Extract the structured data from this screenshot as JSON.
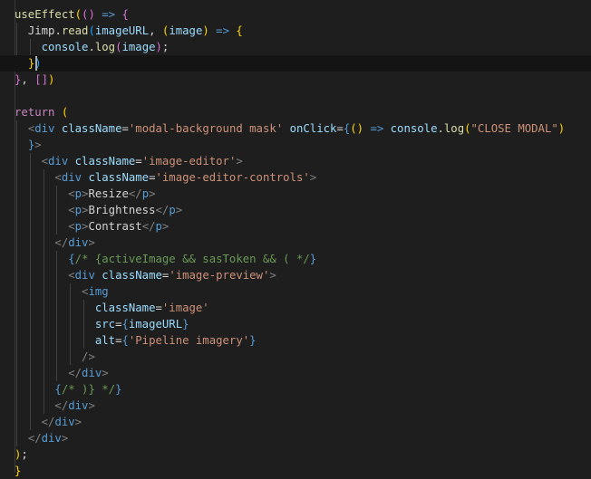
{
  "colors": {
    "background": "#1e1e1e",
    "current_line": "#141414",
    "default": "#d4d4d4",
    "keyword": "#c586c0",
    "storage": "#569cd6",
    "function": "#dcdcaa",
    "variable": "#9cdcfe",
    "string": "#ce9178",
    "comment": "#6a9955",
    "tag": "#569cd6",
    "tag_bracket": "#808080",
    "attribute": "#9cdcfe",
    "bracket_gold": "#ffd700",
    "bracket_pink": "#da70d6",
    "bracket_blue": "#179fff"
  },
  "editor": {
    "language": "javascriptreact",
    "lines": [
      [
        [
          "useEffect",
          "function"
        ],
        [
          "(",
          "bracket_gold"
        ],
        [
          "(",
          "bracket_pink"
        ],
        [
          ")",
          "bracket_pink"
        ],
        [
          " ",
          "default"
        ],
        [
          "=>",
          "storage"
        ],
        [
          " ",
          "default"
        ],
        [
          "{",
          "bracket_pink"
        ]
      ],
      [
        [
          "  ",
          "default"
        ],
        [
          "Jimp",
          "default"
        ],
        [
          ".",
          "default"
        ],
        [
          "read",
          "function"
        ],
        [
          "(",
          "bracket_blue"
        ],
        [
          "imageURL",
          "variable"
        ],
        [
          ", ",
          "default"
        ],
        [
          "(",
          "bracket_gold"
        ],
        [
          "image",
          "variable"
        ],
        [
          ")",
          "bracket_gold"
        ],
        [
          " ",
          "default"
        ],
        [
          "=>",
          "storage"
        ],
        [
          " ",
          "default"
        ],
        [
          "{",
          "bracket_gold"
        ]
      ],
      [
        [
          "    ",
          "default"
        ],
        [
          "console",
          "variable"
        ],
        [
          ".",
          "default"
        ],
        [
          "log",
          "function"
        ],
        [
          "(",
          "bracket_pink"
        ],
        [
          "image",
          "variable"
        ],
        [
          ")",
          "bracket_pink"
        ],
        [
          ";",
          "default"
        ]
      ],
      [
        [
          "  ",
          "default"
        ],
        [
          "}",
          "bracket_gold"
        ],
        [
          ")",
          "bracket_blue"
        ]
      ],
      [
        [
          "}",
          "bracket_pink"
        ],
        [
          ", ",
          "default"
        ],
        [
          "[",
          "bracket_pink"
        ],
        [
          "]",
          "bracket_pink"
        ],
        [
          ")",
          "bracket_gold"
        ]
      ],
      [],
      [
        [
          "return",
          "keyword"
        ],
        [
          " ",
          "default"
        ],
        [
          "(",
          "bracket_gold"
        ]
      ],
      [
        [
          "  ",
          "default"
        ],
        [
          "<",
          "tag_bracket"
        ],
        [
          "div",
          "tag"
        ],
        [
          " ",
          "default"
        ],
        [
          "className",
          "attribute"
        ],
        [
          "=",
          "default"
        ],
        [
          "'modal-background mask'",
          "string"
        ],
        [
          " ",
          "default"
        ],
        [
          "onClick",
          "attribute"
        ],
        [
          "=",
          "default"
        ],
        [
          "{",
          "storage"
        ],
        [
          "(",
          "bracket_gold"
        ],
        [
          ")",
          "bracket_gold"
        ],
        [
          " ",
          "default"
        ],
        [
          "=>",
          "storage"
        ],
        [
          " ",
          "default"
        ],
        [
          "console",
          "variable"
        ],
        [
          ".",
          "default"
        ],
        [
          "log",
          "function"
        ],
        [
          "(",
          "bracket_gold"
        ],
        [
          "\"CLOSE MODAL\"",
          "string"
        ],
        [
          ")",
          "bracket_gold"
        ]
      ],
      [
        [
          "  ",
          "default"
        ],
        [
          "}",
          "storage"
        ],
        [
          ">",
          "tag_bracket"
        ]
      ],
      [
        [
          "    ",
          "default"
        ],
        [
          "<",
          "tag_bracket"
        ],
        [
          "div",
          "tag"
        ],
        [
          " ",
          "default"
        ],
        [
          "className",
          "attribute"
        ],
        [
          "=",
          "default"
        ],
        [
          "'image-editor'",
          "string"
        ],
        [
          ">",
          "tag_bracket"
        ]
      ],
      [
        [
          "      ",
          "default"
        ],
        [
          "<",
          "tag_bracket"
        ],
        [
          "div",
          "tag"
        ],
        [
          " ",
          "default"
        ],
        [
          "className",
          "attribute"
        ],
        [
          "=",
          "default"
        ],
        [
          "'image-editor-controls'",
          "string"
        ],
        [
          ">",
          "tag_bracket"
        ]
      ],
      [
        [
          "        ",
          "default"
        ],
        [
          "<",
          "tag_bracket"
        ],
        [
          "p",
          "tag"
        ],
        [
          ">",
          "tag_bracket"
        ],
        [
          "Resize",
          "default"
        ],
        [
          "</",
          "tag_bracket"
        ],
        [
          "p",
          "tag"
        ],
        [
          ">",
          "tag_bracket"
        ]
      ],
      [
        [
          "        ",
          "default"
        ],
        [
          "<",
          "tag_bracket"
        ],
        [
          "p",
          "tag"
        ],
        [
          ">",
          "tag_bracket"
        ],
        [
          "Brightness",
          "default"
        ],
        [
          "</",
          "tag_bracket"
        ],
        [
          "p",
          "tag"
        ],
        [
          ">",
          "tag_bracket"
        ]
      ],
      [
        [
          "        ",
          "default"
        ],
        [
          "<",
          "tag_bracket"
        ],
        [
          "p",
          "tag"
        ],
        [
          ">",
          "tag_bracket"
        ],
        [
          "Contrast",
          "default"
        ],
        [
          "</",
          "tag_bracket"
        ],
        [
          "p",
          "tag"
        ],
        [
          ">",
          "tag_bracket"
        ]
      ],
      [
        [
          "      ",
          "default"
        ],
        [
          "</",
          "tag_bracket"
        ],
        [
          "div",
          "tag"
        ],
        [
          ">",
          "tag_bracket"
        ]
      ],
      [
        [
          "        ",
          "default"
        ],
        [
          "{",
          "storage"
        ],
        [
          "/* {activeImage && sasToken && ( */",
          "comment"
        ],
        [
          "}",
          "storage"
        ]
      ],
      [
        [
          "        ",
          "default"
        ],
        [
          "<",
          "tag_bracket"
        ],
        [
          "div",
          "tag"
        ],
        [
          " ",
          "default"
        ],
        [
          "className",
          "attribute"
        ],
        [
          "=",
          "default"
        ],
        [
          "'image-preview'",
          "string"
        ],
        [
          ">",
          "tag_bracket"
        ]
      ],
      [
        [
          "          ",
          "default"
        ],
        [
          "<",
          "tag_bracket"
        ],
        [
          "img",
          "tag"
        ]
      ],
      [
        [
          "            ",
          "default"
        ],
        [
          "className",
          "attribute"
        ],
        [
          "=",
          "default"
        ],
        [
          "'image'",
          "string"
        ]
      ],
      [
        [
          "            ",
          "default"
        ],
        [
          "src",
          "attribute"
        ],
        [
          "=",
          "default"
        ],
        [
          "{",
          "storage"
        ],
        [
          "imageURL",
          "variable"
        ],
        [
          "}",
          "storage"
        ]
      ],
      [
        [
          "            ",
          "default"
        ],
        [
          "alt",
          "attribute"
        ],
        [
          "=",
          "default"
        ],
        [
          "{",
          "storage"
        ],
        [
          "'Pipeline imagery'",
          "string"
        ],
        [
          "}",
          "storage"
        ]
      ],
      [
        [
          "          ",
          "default"
        ],
        [
          "/>",
          "tag_bracket"
        ]
      ],
      [
        [
          "        ",
          "default"
        ],
        [
          "</",
          "tag_bracket"
        ],
        [
          "div",
          "tag"
        ],
        [
          ">",
          "tag_bracket"
        ]
      ],
      [
        [
          "      ",
          "default"
        ],
        [
          "{",
          "storage"
        ],
        [
          "/* )} */",
          "comment"
        ],
        [
          "}",
          "storage"
        ]
      ],
      [
        [
          "      ",
          "default"
        ],
        [
          "</",
          "tag_bracket"
        ],
        [
          "div",
          "tag"
        ],
        [
          ">",
          "tag_bracket"
        ]
      ],
      [
        [
          "    ",
          "default"
        ],
        [
          "</",
          "tag_bracket"
        ],
        [
          "div",
          "tag"
        ],
        [
          ">",
          "tag_bracket"
        ]
      ],
      [
        [
          "  ",
          "default"
        ],
        [
          "</",
          "tag_bracket"
        ],
        [
          "div",
          "tag"
        ],
        [
          ">",
          "tag_bracket"
        ]
      ],
      [
        [
          ")",
          "bracket_gold"
        ],
        [
          ";",
          "default"
        ]
      ],
      [
        [
          "}",
          "bracket_gold"
        ]
      ]
    ]
  }
}
